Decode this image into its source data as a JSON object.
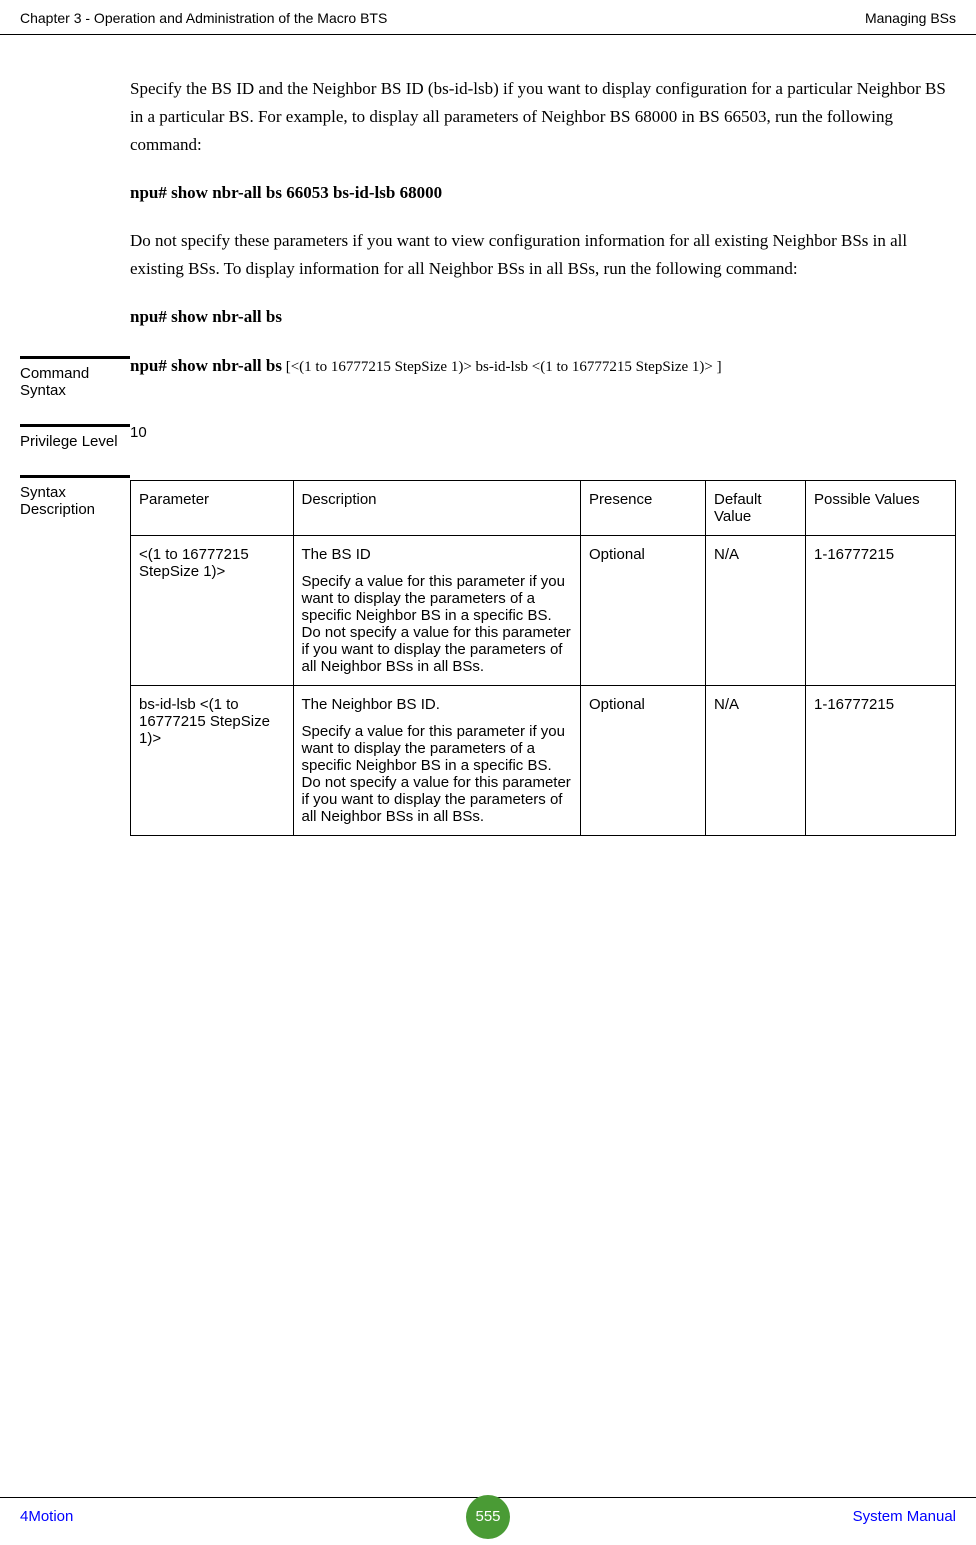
{
  "header": {
    "left": "Chapter 3 - Operation and Administration of the Macro BTS",
    "right": "Managing BSs"
  },
  "body": {
    "intro1": "Specify the BS ID and the Neighbor BS ID (bs-id-lsb) if you want to display configuration for a particular Neighbor BS in a particular BS. For example, to display all parameters of Neighbor BS 68000 in BS 66503, run the following command:",
    "cmd1": "npu# show nbr-all bs 66053 bs-id-lsb 68000",
    "intro2": "Do not specify these parameters if you want to view configuration information for all existing Neighbor BSs in all existing BSs. To display information for all Neighbor BSs in all BSs, run the following command:",
    "cmd2": "npu# show nbr-all bs"
  },
  "sections": {
    "command_syntax": {
      "label": "Command Syntax",
      "bold": "npu# show nbr-all bs",
      "rest": " [<(1 to 16777215 StepSize 1)> bs-id-lsb <(1 to 16777215 StepSize 1)> ]"
    },
    "privilege": {
      "label": "Privilege Level",
      "value": "10"
    },
    "syntax_desc": {
      "label": "Syntax Description",
      "headers": {
        "parameter": "Parameter",
        "description": "Description",
        "presence": "Presence",
        "default": "Default Value",
        "possible": "Possible Values"
      },
      "rows": [
        {
          "parameter": "<(1 to 16777215 StepSize 1)>",
          "desc_line1": "The BS ID",
          "desc_line2": "Specify a value for this parameter if you want to display the parameters of a specific Neighbor BS in a specific BS. Do not specify a value for this parameter if you want to display the parameters of all Neighbor BSs in all BSs.",
          "presence": "Optional",
          "default": "N/A",
          "possible": "1-16777215"
        },
        {
          "parameter": "bs-id-lsb <(1 to 16777215 StepSize 1)>",
          "desc_line1": "The Neighbor BS ID.",
          "desc_line2": "Specify a value for this parameter if you want to display the parameters of a specific Neighbor BS in a specific BS. Do not specify a value for this parameter if you want to display the parameters of all Neighbor BSs in all BSs.",
          "presence": "Optional",
          "default": "N/A",
          "possible": "1-16777215"
        }
      ]
    }
  },
  "footer": {
    "left": "4Motion",
    "page": "555",
    "right": "System Manual"
  }
}
